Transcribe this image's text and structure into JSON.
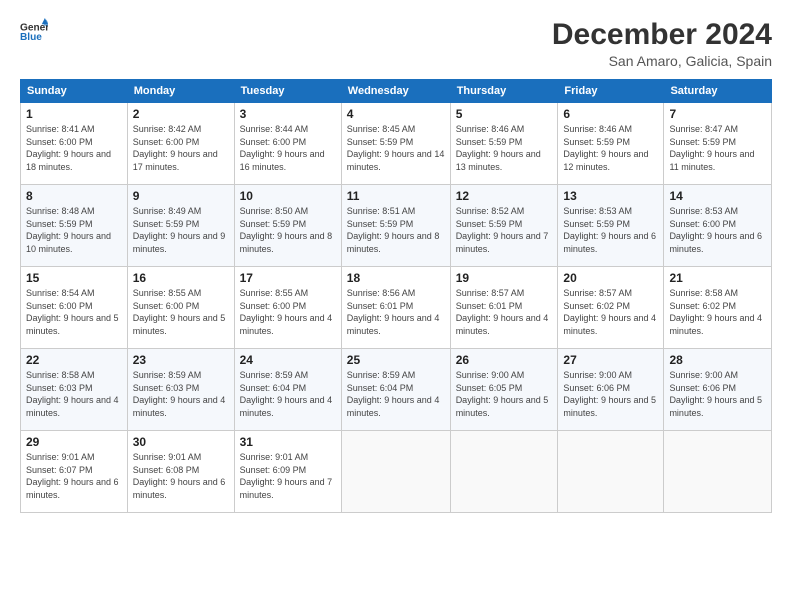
{
  "header": {
    "logo_line1": "General",
    "logo_line2": "Blue",
    "month": "December 2024",
    "location": "San Amaro, Galicia, Spain"
  },
  "weekdays": [
    "Sunday",
    "Monday",
    "Tuesday",
    "Wednesday",
    "Thursday",
    "Friday",
    "Saturday"
  ],
  "weeks": [
    [
      {
        "day": "1",
        "sunrise": "8:41 AM",
        "sunset": "6:00 PM",
        "daylight": "9 hours and 18 minutes."
      },
      {
        "day": "2",
        "sunrise": "8:42 AM",
        "sunset": "6:00 PM",
        "daylight": "9 hours and 17 minutes."
      },
      {
        "day": "3",
        "sunrise": "8:44 AM",
        "sunset": "6:00 PM",
        "daylight": "9 hours and 16 minutes."
      },
      {
        "day": "4",
        "sunrise": "8:45 AM",
        "sunset": "5:59 PM",
        "daylight": "9 hours and 14 minutes."
      },
      {
        "day": "5",
        "sunrise": "8:46 AM",
        "sunset": "5:59 PM",
        "daylight": "9 hours and 13 minutes."
      },
      {
        "day": "6",
        "sunrise": "8:46 AM",
        "sunset": "5:59 PM",
        "daylight": "9 hours and 12 minutes."
      },
      {
        "day": "7",
        "sunrise": "8:47 AM",
        "sunset": "5:59 PM",
        "daylight": "9 hours and 11 minutes."
      }
    ],
    [
      {
        "day": "8",
        "sunrise": "8:48 AM",
        "sunset": "5:59 PM",
        "daylight": "9 hours and 10 minutes."
      },
      {
        "day": "9",
        "sunrise": "8:49 AM",
        "sunset": "5:59 PM",
        "daylight": "9 hours and 9 minutes."
      },
      {
        "day": "10",
        "sunrise": "8:50 AM",
        "sunset": "5:59 PM",
        "daylight": "9 hours and 8 minutes."
      },
      {
        "day": "11",
        "sunrise": "8:51 AM",
        "sunset": "5:59 PM",
        "daylight": "9 hours and 8 minutes."
      },
      {
        "day": "12",
        "sunrise": "8:52 AM",
        "sunset": "5:59 PM",
        "daylight": "9 hours and 7 minutes."
      },
      {
        "day": "13",
        "sunrise": "8:53 AM",
        "sunset": "5:59 PM",
        "daylight": "9 hours and 6 minutes."
      },
      {
        "day": "14",
        "sunrise": "8:53 AM",
        "sunset": "6:00 PM",
        "daylight": "9 hours and 6 minutes."
      }
    ],
    [
      {
        "day": "15",
        "sunrise": "8:54 AM",
        "sunset": "6:00 PM",
        "daylight": "9 hours and 5 minutes."
      },
      {
        "day": "16",
        "sunrise": "8:55 AM",
        "sunset": "6:00 PM",
        "daylight": "9 hours and 5 minutes."
      },
      {
        "day": "17",
        "sunrise": "8:55 AM",
        "sunset": "6:00 PM",
        "daylight": "9 hours and 4 minutes."
      },
      {
        "day": "18",
        "sunrise": "8:56 AM",
        "sunset": "6:01 PM",
        "daylight": "9 hours and 4 minutes."
      },
      {
        "day": "19",
        "sunrise": "8:57 AM",
        "sunset": "6:01 PM",
        "daylight": "9 hours and 4 minutes."
      },
      {
        "day": "20",
        "sunrise": "8:57 AM",
        "sunset": "6:02 PM",
        "daylight": "9 hours and 4 minutes."
      },
      {
        "day": "21",
        "sunrise": "8:58 AM",
        "sunset": "6:02 PM",
        "daylight": "9 hours and 4 minutes."
      }
    ],
    [
      {
        "day": "22",
        "sunrise": "8:58 AM",
        "sunset": "6:03 PM",
        "daylight": "9 hours and 4 minutes."
      },
      {
        "day": "23",
        "sunrise": "8:59 AM",
        "sunset": "6:03 PM",
        "daylight": "9 hours and 4 minutes."
      },
      {
        "day": "24",
        "sunrise": "8:59 AM",
        "sunset": "6:04 PM",
        "daylight": "9 hours and 4 minutes."
      },
      {
        "day": "25",
        "sunrise": "8:59 AM",
        "sunset": "6:04 PM",
        "daylight": "9 hours and 4 minutes."
      },
      {
        "day": "26",
        "sunrise": "9:00 AM",
        "sunset": "6:05 PM",
        "daylight": "9 hours and 5 minutes."
      },
      {
        "day": "27",
        "sunrise": "9:00 AM",
        "sunset": "6:06 PM",
        "daylight": "9 hours and 5 minutes."
      },
      {
        "day": "28",
        "sunrise": "9:00 AM",
        "sunset": "6:06 PM",
        "daylight": "9 hours and 5 minutes."
      }
    ],
    [
      {
        "day": "29",
        "sunrise": "9:01 AM",
        "sunset": "6:07 PM",
        "daylight": "9 hours and 6 minutes."
      },
      {
        "day": "30",
        "sunrise": "9:01 AM",
        "sunset": "6:08 PM",
        "daylight": "9 hours and 6 minutes."
      },
      {
        "day": "31",
        "sunrise": "9:01 AM",
        "sunset": "6:09 PM",
        "daylight": "9 hours and 7 minutes."
      },
      null,
      null,
      null,
      null
    ]
  ],
  "labels": {
    "sunrise": "Sunrise:",
    "sunset": "Sunset:",
    "daylight": "Daylight:"
  }
}
